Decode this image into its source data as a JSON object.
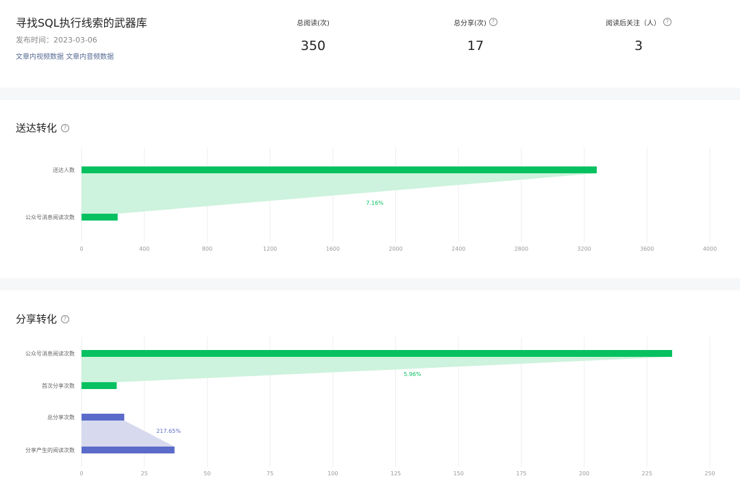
{
  "article": {
    "title": "寻找SQL执行线索的武器库",
    "publish_label": "发布时间：",
    "publish_date": "2023-03-06",
    "link_video": "文章内视频数据",
    "link_audio": "文章内音频数据"
  },
  "stats": [
    {
      "label": "总阅读(次)",
      "value": "350",
      "help": false
    },
    {
      "label": "总分享(次)",
      "value": "17",
      "help": true
    },
    {
      "label": "阅读后关注（人）",
      "value": "3",
      "help": true
    }
  ],
  "help_glyph": "?",
  "colors": {
    "green": "#07c160",
    "green_fill": "#cdf2dd",
    "blue": "#5b6bc9",
    "blue_fill": "#d7daee",
    "grid": "#eeeeee"
  },
  "chart_data": [
    {
      "type": "bar",
      "title": "送达转化",
      "categories": [
        "送达人数",
        "公众号消息阅读次数"
      ],
      "values": [
        3280,
        230
      ],
      "conversion": "7.16%",
      "xlim": [
        0,
        4000
      ],
      "xticks": [
        0,
        400,
        800,
        1200,
        1600,
        2000,
        2400,
        2800,
        3200,
        3600,
        4000
      ]
    },
    {
      "type": "bar",
      "title": "分享转化",
      "categories": [
        "公众号消息阅读次数",
        "首次分享次数",
        "总分享次数",
        "分享产生的阅读次数"
      ],
      "values": [
        235,
        14,
        17,
        37
      ],
      "conversions": [
        "5.96%",
        "217.65%"
      ],
      "xlim": [
        0,
        250
      ],
      "xticks": [
        0,
        25,
        50,
        75,
        100,
        125,
        150,
        175,
        200,
        225,
        250
      ]
    }
  ]
}
